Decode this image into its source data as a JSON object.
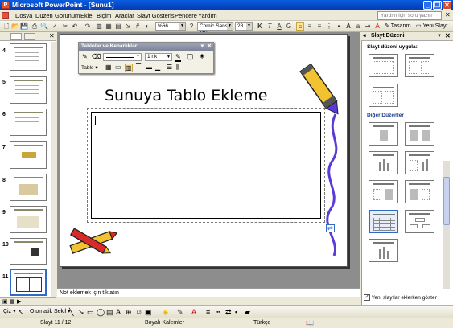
{
  "window": {
    "title": "Microsoft PowerPoint - [Sunu1]",
    "minimize": "_",
    "restore": "❐",
    "close": "✕"
  },
  "menu": [
    "Dosya",
    "Düzen",
    "Görünüm",
    "Ekle",
    "Biçim",
    "Araçlar",
    "Slayt Gösterisi",
    "Pencere",
    "Yardım"
  ],
  "help_placeholder": "Yardım için soru yazın",
  "toolbar": {
    "zoom": "%66",
    "font": "Comic Sans MS",
    "font_size": "28",
    "bold": "K",
    "italic": "T",
    "underline": "A",
    "shadow": "G",
    "design": "Tasarım",
    "new_slide": "Yeni Slayt"
  },
  "slides": [
    {
      "num": "4"
    },
    {
      "num": "5"
    },
    {
      "num": "6"
    },
    {
      "num": "7"
    },
    {
      "num": "8"
    },
    {
      "num": "9"
    },
    {
      "num": "10"
    },
    {
      "num": "11"
    }
  ],
  "slide": {
    "title": "Sunuya Tablo Ekleme"
  },
  "notes_placeholder": "Not eklemek için tıklatın",
  "table_toolbar": {
    "title": "Tablolar ve Kenarlıklar",
    "line_weight": "1 nk",
    "table_menu": "Tablo"
  },
  "task_pane": {
    "title": "Slayt Düzeni",
    "apply_label": "Slayt düzeni uygula:",
    "other_label": "Diğer Düzenler",
    "show_checkbox": "Yeni slaytlar eklerken göster"
  },
  "drawbar": {
    "draw": "Çiz",
    "autoshapes": "Otomatik Şekil"
  },
  "status": {
    "slide": "Slayt 11 / 12",
    "design": "Boyalı Kalemler",
    "language": "Türkçe"
  },
  "colors": {
    "title_bar": "#0548c8",
    "pane_heading": "#1d3b8a",
    "slide_bg": "#ffffff",
    "purple_squiggle": "#5a3bd6"
  }
}
